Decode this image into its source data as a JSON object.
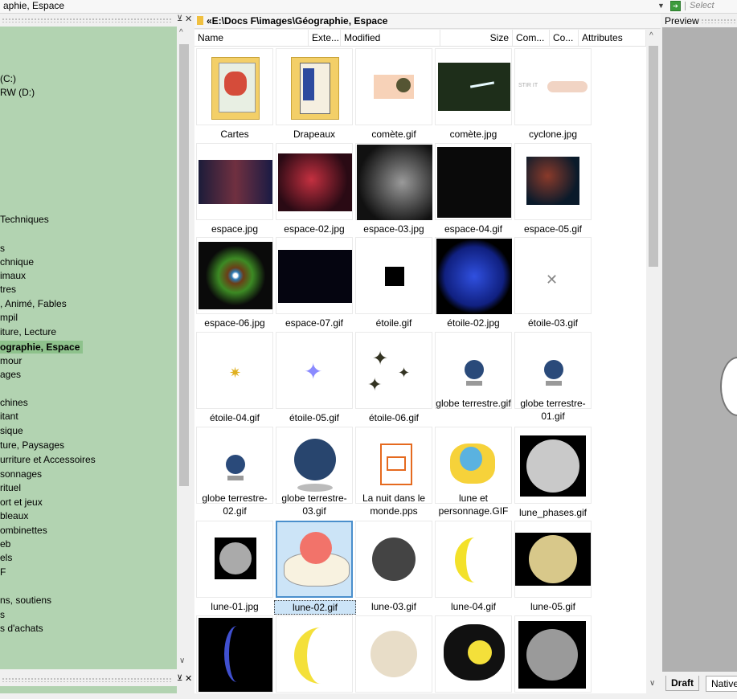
{
  "topbar": {
    "path": "aphie, Espace",
    "select_placeholder": "Select"
  },
  "file_panel": {
    "path": "«E:\\Docs F\\images\\Géographie, Espace"
  },
  "columns": [
    "Name",
    "Exte...",
    "Modified",
    "Size",
    "Com...",
    "Co...",
    "Attributes"
  ],
  "tree": [
    "(C:)",
    "RW (D:)",
    "Techniques",
    "s",
    "chnique",
    "imaux",
    "tres",
    ", Animé, Fables",
    "mpil",
    "iture, Lecture",
    "ographie, Espace",
    "mour",
    "ages",
    "chines",
    "itant",
    "sique",
    "ture, Paysages",
    "urriture et Accessoires",
    "sonnages",
    "rituel",
    "ort et jeux",
    "bleaux",
    "ombinettes",
    "eb",
    "els",
    "F",
    "ns, soutiens",
    "s",
    "s d'achats"
  ],
  "files": [
    {
      "label": "Cartes"
    },
    {
      "label": "Drapeaux"
    },
    {
      "label": "comète.gif"
    },
    {
      "label": "comète.jpg"
    },
    {
      "label": "cyclone.jpg"
    },
    {
      "label": "espace.jpg"
    },
    {
      "label": "espace-02.jpg"
    },
    {
      "label": "espace-03.jpg"
    },
    {
      "label": "espace-04.gif"
    },
    {
      "label": "espace-05.gif"
    },
    {
      "label": "espace-06.jpg"
    },
    {
      "label": "espace-07.gif"
    },
    {
      "label": "étoile.gif"
    },
    {
      "label": "étoile-02.jpg"
    },
    {
      "label": "étoile-03.gif"
    },
    {
      "label": "étoile-04.gif"
    },
    {
      "label": "étoile-05.gif"
    },
    {
      "label": "étoile-06.gif"
    },
    {
      "label": "globe terrestre.gif"
    },
    {
      "label": "globe terrestre-01.gif"
    },
    {
      "label": "globe terrestre-02.gif"
    },
    {
      "label": "globe terrestre-03.gif"
    },
    {
      "label": "La nuit dans le monde.pps"
    },
    {
      "label": "lune et personnage.GIF"
    },
    {
      "label": "lune_phases.gif"
    },
    {
      "label": "lune-01.jpg"
    },
    {
      "label": "lune-02.gif"
    },
    {
      "label": "lune-03.gif"
    },
    {
      "label": "lune-04.gif"
    },
    {
      "label": "lune-05.gif"
    },
    {
      "label": ""
    },
    {
      "label": ""
    },
    {
      "label": ""
    },
    {
      "label": ""
    },
    {
      "label": ""
    }
  ],
  "preview": {
    "title": "Preview",
    "tabs": [
      "Draft",
      "Native"
    ]
  },
  "colors": {
    "tree_bg": "#b2d3b1",
    "selection": "#cce4f7",
    "preview_bg": "#b0b0b0"
  }
}
